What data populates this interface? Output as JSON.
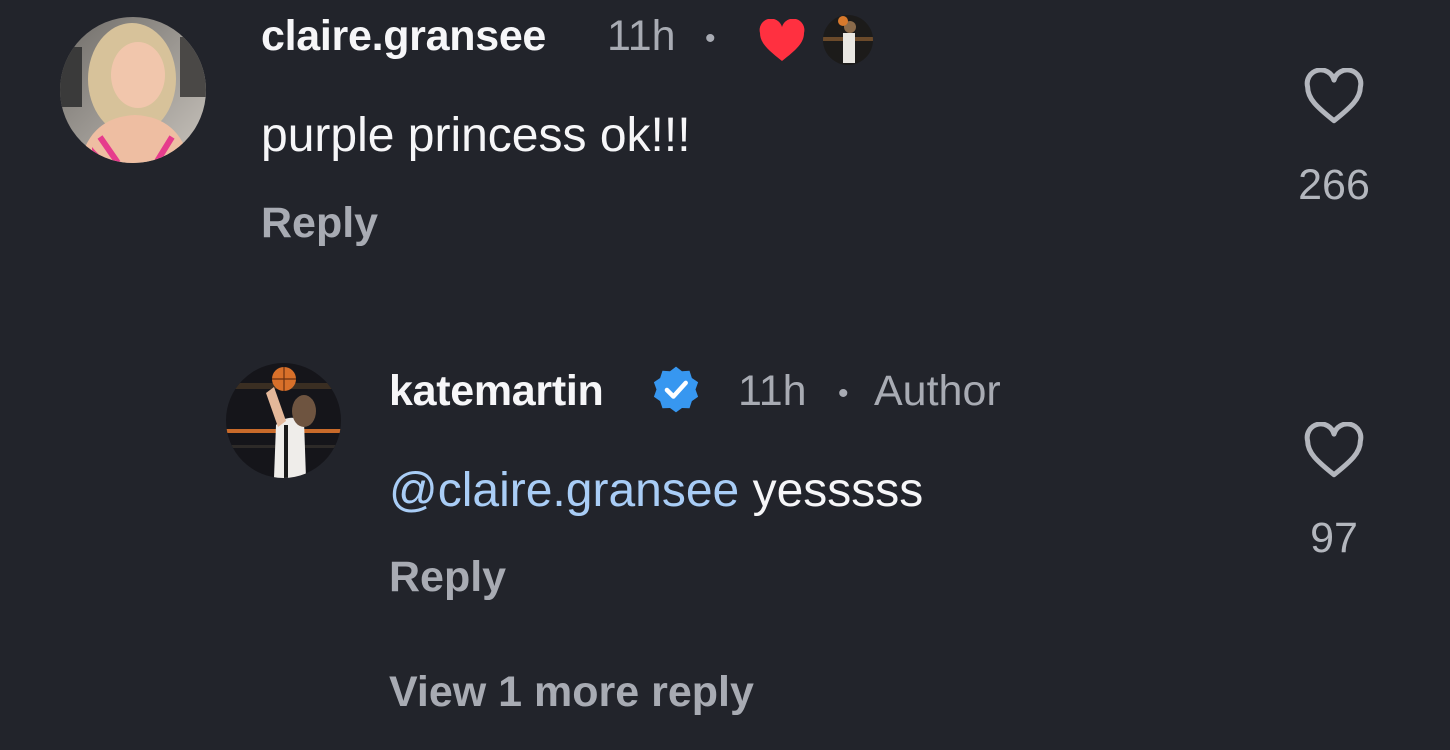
{
  "comments": [
    {
      "username": "claire.gransee",
      "time": "11h",
      "separator": "•",
      "text": "purple princess ok!!!",
      "reply_label": "Reply",
      "like_count": "266",
      "liked_by_author": true
    },
    {
      "username": "katemartin",
      "verified": true,
      "time": "11h",
      "separator": "•",
      "badge": "Author",
      "mention": "@claire.gransee",
      "text": "yesssss",
      "reply_label": "Reply",
      "like_count": "97"
    }
  ],
  "view_more_label": "View 1 more reply",
  "colors": {
    "background": "#22242b",
    "text_primary": "#f6f6f8",
    "text_secondary": "#a8abb3",
    "mention": "#a9cdf6",
    "heart_red": "#ff3040",
    "verified_blue": "#3797f0"
  },
  "icons": [
    "heart-filled-icon",
    "heart-outline-icon",
    "verified-badge-icon"
  ]
}
